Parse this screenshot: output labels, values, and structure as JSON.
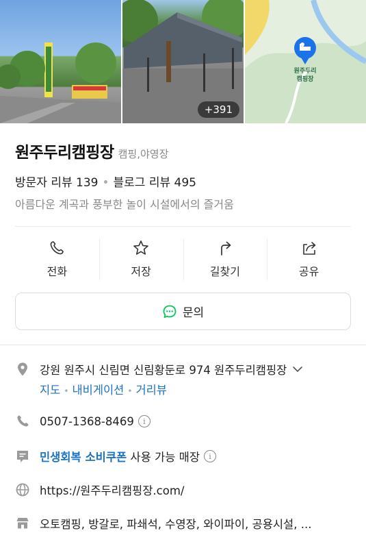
{
  "photos": {
    "more_count": "+391",
    "map_pin_label_line1": "원주두리",
    "map_pin_label_line2": "캠핑장"
  },
  "place": {
    "name": "원주두리캠핑장",
    "category": "캠핑,야영장",
    "visitor_reviews": "방문자 리뷰 139",
    "blog_reviews": "블로그 리뷰 495",
    "tagline": "아름다운 계곡과 풍부한 놀이 시설에서의 즐거움"
  },
  "actions": [
    {
      "label": "전화",
      "icon": "phone-icon"
    },
    {
      "label": "저장",
      "icon": "star-icon"
    },
    {
      "label": "길찾기",
      "icon": "directions-icon"
    },
    {
      "label": "공유",
      "icon": "share-icon"
    }
  ],
  "inquiry": {
    "label": "문의",
    "icon": "chat-icon",
    "color": "#03c75a"
  },
  "details": {
    "address": "강원 원주시 신림면 신림황둔로 974 원주두리캠핑장",
    "address_links": [
      "지도",
      "내비게이션",
      "거리뷰"
    ],
    "phone": "0507-1368-8469",
    "coupon_highlight": "민생회복 소비쿠폰",
    "coupon_rest": " 사용 가능 매장",
    "website": "https://원주두리캠핑장.com/",
    "amenities": "오토캠핑, 방갈로, 파쇄석, 수영장, 와이파이, 공용시설, ..."
  },
  "colors": {
    "link": "#1a73c6",
    "brand_green": "#03c75a",
    "icon_gray": "#9a9a9a"
  }
}
